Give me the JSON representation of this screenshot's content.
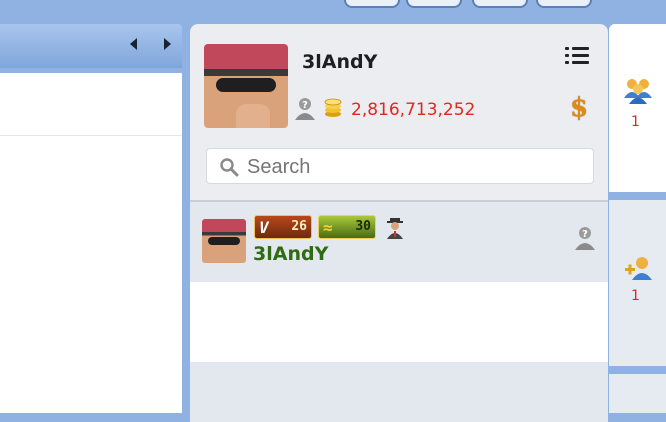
{
  "profile": {
    "username": "3lAndY",
    "coins": "2,816,713,252"
  },
  "search": {
    "placeholder": "Search"
  },
  "contacts": [
    {
      "username": "3lAndY",
      "vip_level": "26",
      "rank_level": "30"
    }
  ],
  "sidebar_right": {
    "friends_count": "1",
    "requests_count": "1"
  },
  "icons": {
    "menu": "list-menu-icon",
    "coin": "coin-stack-icon",
    "dollar": "dollar-icon",
    "help_user": "unknown-user-icon",
    "search": "magnifier-icon",
    "agent": "agent-icon",
    "friends": "friends-group-icon",
    "add_friend": "add-friend-icon"
  },
  "colors": {
    "coins": "#e0281c",
    "username_online": "#2e6b12",
    "accent_bg": "#8fb2e2"
  }
}
